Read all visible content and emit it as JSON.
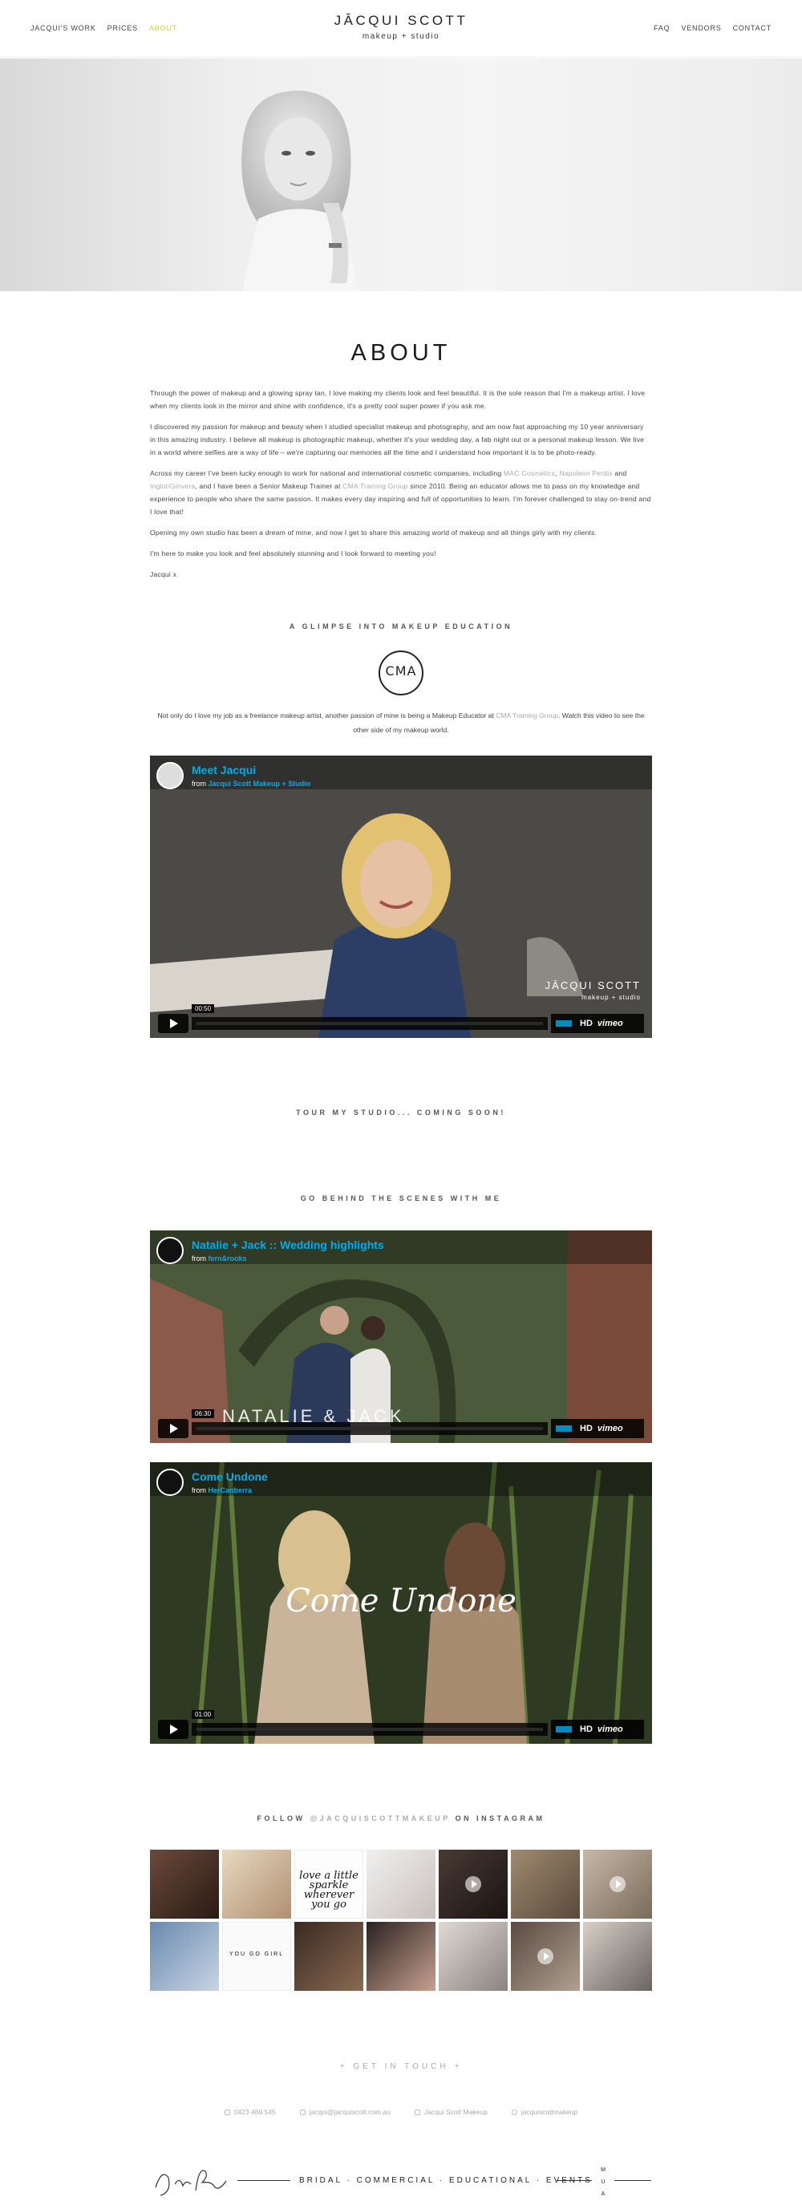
{
  "header": {
    "nav_left": [
      "JACQUI'S WORK",
      "PRICES",
      "ABOUT"
    ],
    "nav_right": [
      "FAQ",
      "VENDORS",
      "CONTACT"
    ],
    "logo_name": "JĀCQUI SCOTT",
    "logo_sub": "makeup + studio",
    "accent_color": "#c8d63a"
  },
  "about": {
    "title": "ABOUT",
    "p1": "Through the power of makeup and a glowing spray tan, I love making my clients look and feel beautiful. It is the sole reason that I'm a makeup artist. I love when my clients look in the mirror and shine with confidence, it's a pretty cool super power if you ask me.",
    "p2": "I discovered my passion for makeup and beauty when I studied specialist makeup and photography, and am now fast approaching my 10 year anniversary in this amazing industry. I believe all makeup is photographic makeup, whether it's your wedding day, a fab night out or a personal makeup lesson. We live in a world where selfies are a way of life – we're capturing our memories all the time and I understand how important it is to be photo-ready.",
    "p3_a": "Across my career I've been lucky enough to work for national and international cosmetic companies, including ",
    "p3_mac": "MAC Cosmetics",
    "p3_b": ", ",
    "p3_napoleon": "Napoleon Perdis",
    "p3_c": " and ",
    "p3_benecos": "Inglot/Ginvera",
    "p3_d": ", and I have been a Senior Makeup Trainer at ",
    "p3_cma": "CMA Training Group",
    "p3_e": " since 2010. Being an educator allows me to pass on my knowledge and experience to people who share the same passion. It makes every day inspiring and full of opportunities to learn. I'm forever challenged to stay on-trend and I love that!",
    "p4": "Opening my own studio has been a dream of mine, and now I get to share this amazing world of makeup and all things girly with my clients.",
    "p5": "I'm here to make you look and feel absolutely stunning and I look forward to meeting you!",
    "sign": "Jacqui x"
  },
  "education": {
    "heading": "A GLIMPSE INTO MAKEUP EDUCATION",
    "logo_text": "CMA",
    "text_a": "Not only do I love my job as a freelance makeup artist, another passion of mine is being a Makeup Educator at ",
    "text_link": "CMA Training Group",
    "text_b": ". Watch this video to see the other side of my makeup world."
  },
  "videos": [
    {
      "title": "Meet Jacqui",
      "from_label": "from",
      "author": "Jacqui Scott Makeup + Studio",
      "time": "00:50",
      "hd": "HD",
      "brand": "vimeo",
      "overlay_name": "JĀCQUI SCOTT",
      "overlay_sub": "makeup + studio"
    },
    {
      "title": "Natalie + Jack :: Wedding highlights",
      "from_label": "from",
      "author": "fern&rooks",
      "time": "06:30",
      "hd": "HD",
      "brand": "vimeo",
      "overlay_name": "NATALIE & JACK"
    },
    {
      "title": "Come Undone",
      "from_label": "from",
      "author": "HerCanberra",
      "time": "01:00",
      "hd": "HD",
      "brand": "vimeo",
      "overlay_name": "Come Undone"
    }
  ],
  "studio": {
    "heading": "TOUR MY STUDIO... COMING SOON!"
  },
  "behind": {
    "heading": "GO BEHIND THE SCENES WITH ME"
  },
  "instagram": {
    "prefix": "FOLLOW",
    "handle": "@JACQUISCOTTMAKEUP",
    "suffix": "ON INSTAGRAM",
    "tile_quote": "love a little sparkle wherever you go",
    "tile_quote2": "YOU GO GIRL"
  },
  "contact": {
    "get_in_touch": "+ GET IN TOUCH +",
    "phone": "0423 469 545",
    "email": "jacqui@jacquiscott.com.au",
    "facebook": "Jacqui Scott Makeup",
    "instagram": "jacquiscottmakeup"
  },
  "footer": {
    "tagline": "BRIDAL · COMMERCIAL · EDUCATIONAL · EVENTS",
    "mua": "MUA"
  }
}
